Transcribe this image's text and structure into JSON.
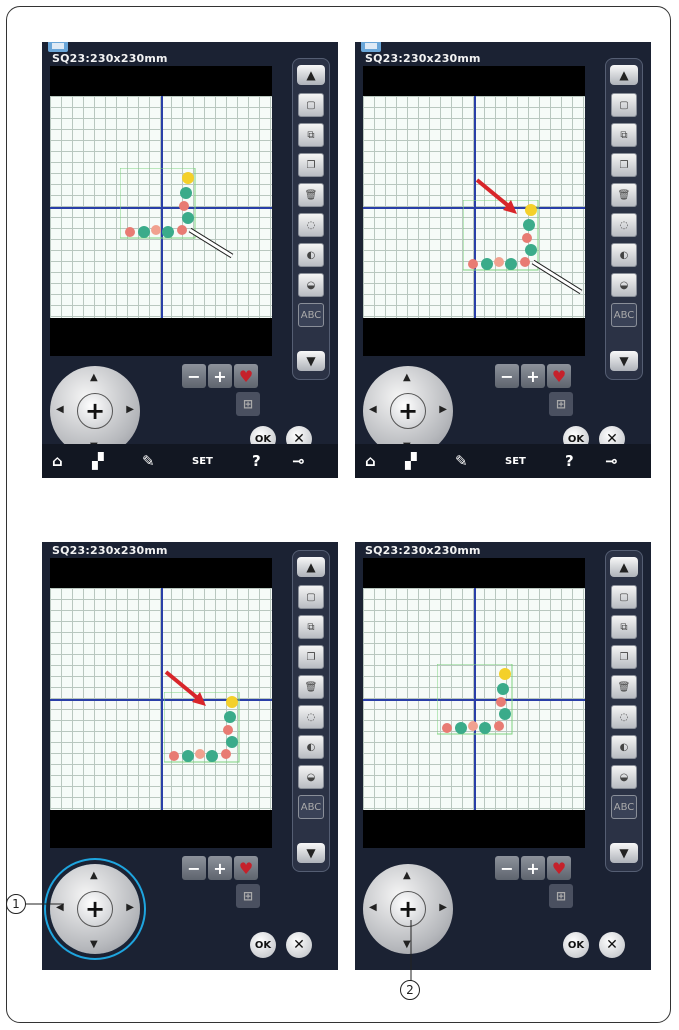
{
  "panels": [
    {
      "hoop_label": "SQ23:230x230mm",
      "ok_label": "OK",
      "cancel_label": "✕"
    },
    {
      "hoop_label": "SQ23:230x230mm",
      "ok_label": "OK",
      "cancel_label": "✕"
    },
    {
      "hoop_label": "SQ23:230x230mm",
      "ok_label": "OK",
      "cancel_label": "✕"
    },
    {
      "hoop_label": "SQ23:230x230mm",
      "ok_label": "OK",
      "cancel_label": "✕"
    }
  ],
  "side_buttons": [
    "scroll-up",
    "new-window",
    "copy",
    "duplicate",
    "delete",
    "rotate",
    "flip-horizontal",
    "flip-vertical",
    "abc",
    "scroll-down"
  ],
  "size_controls": {
    "minus": "−",
    "plus": "+"
  },
  "bottom_bar": {
    "help": "?",
    "set": "SET"
  },
  "callouts": {
    "one": "1",
    "two": "2"
  },
  "colors": {
    "accent_axis": "#2a3fa8",
    "arrow": "#d8252a",
    "callout_ring": "#1ea5df",
    "frame_outline": "#7fd37f"
  }
}
